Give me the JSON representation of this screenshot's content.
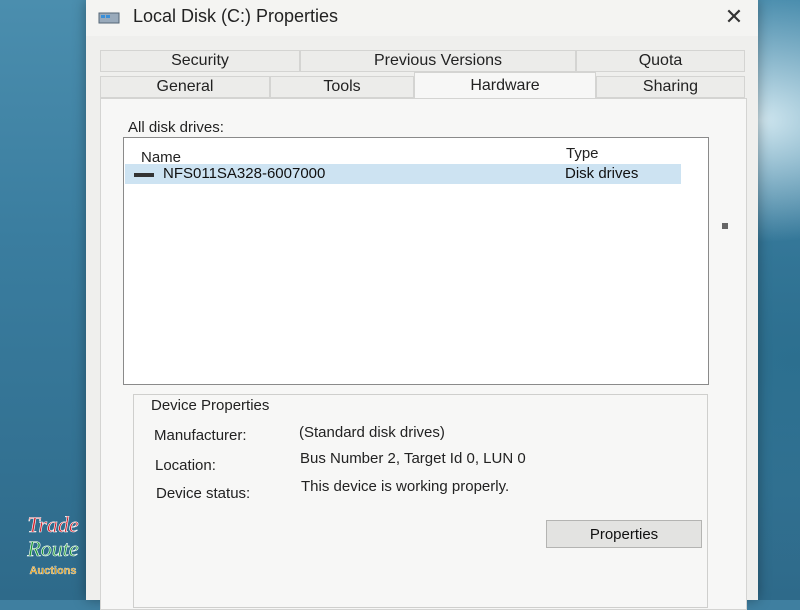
{
  "window": {
    "title": "Local Disk (C:) Properties",
    "close_glyph": "✕"
  },
  "tabs": {
    "row1": [
      {
        "label": "Security"
      },
      {
        "label": "Previous Versions"
      },
      {
        "label": "Quota"
      }
    ],
    "row2": [
      {
        "label": "General"
      },
      {
        "label": "Tools"
      },
      {
        "label": "Hardware",
        "active": true
      },
      {
        "label": "Sharing"
      }
    ]
  },
  "hardware": {
    "all_drives_label": "All disk drives:",
    "columns": {
      "name": "Name",
      "type": "Type"
    },
    "drives": [
      {
        "name": "NFS011SA328-6007000",
        "type": "Disk drives",
        "selected": true
      }
    ],
    "device_properties": {
      "title": "Device Properties",
      "manufacturer_label": "Manufacturer:",
      "manufacturer_value": "(Standard disk drives)",
      "location_label": "Location:",
      "location_value": "Bus Number 2, Target Id 0, LUN 0",
      "status_label": "Device status:",
      "status_value": "This device is working properly."
    },
    "properties_button": "Properties"
  },
  "watermark": {
    "line1": "Trade",
    "line2": "Route",
    "line3": "Auctions"
  },
  "colors": {
    "selection": "#cde3f2",
    "window_bg": "#f7f7f6",
    "desktop": "#3f7fa0"
  }
}
